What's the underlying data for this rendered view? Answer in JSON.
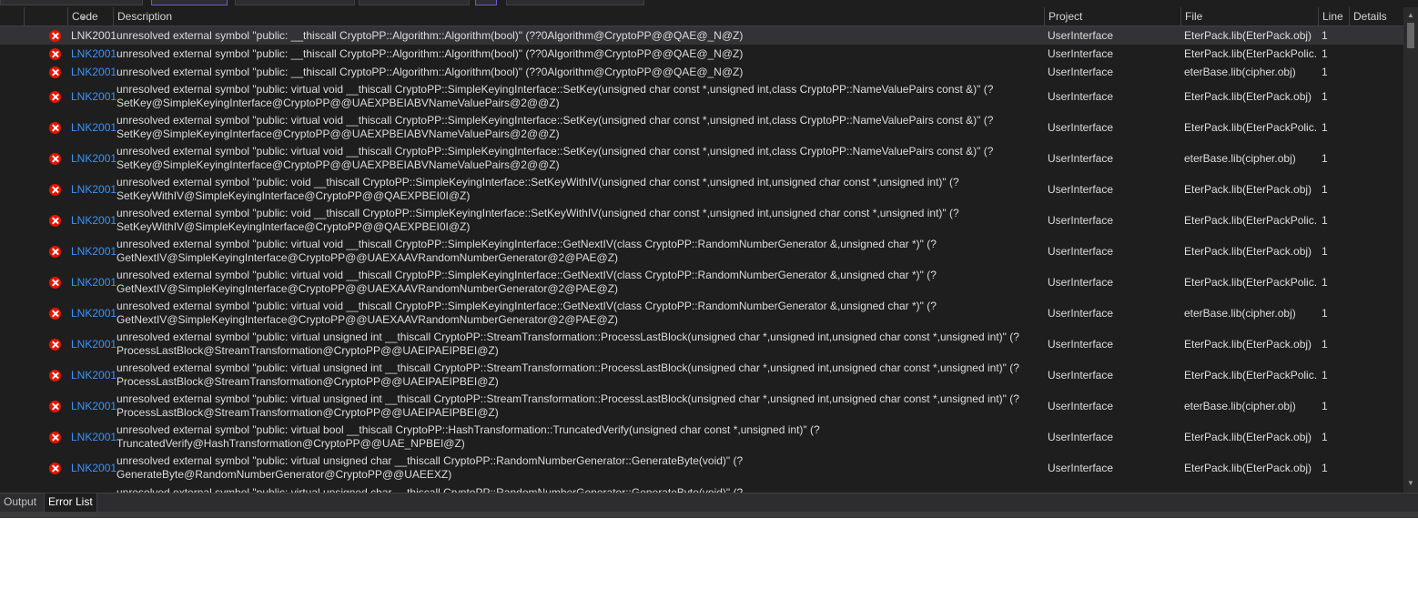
{
  "header": {
    "code": "Code",
    "description": "Description",
    "project": "Project",
    "file": "File",
    "line": "Line",
    "details": "Details"
  },
  "rows": [
    {
      "code": "LNK2001",
      "description": "unresolved external symbol \"public: __thiscall CryptoPP::Algorithm::Algorithm(bool)\" (??0Algorithm@CryptoPP@@QAE@_N@Z)",
      "project": "UserInterface",
      "file": "EterPack.lib(EterPack.obj)",
      "line": "1",
      "selected": true
    },
    {
      "code": "LNK2001",
      "description": "unresolved external symbol \"public: __thiscall CryptoPP::Algorithm::Algorithm(bool)\" (??0Algorithm@CryptoPP@@QAE@_N@Z)",
      "project": "UserInterface",
      "file": "EterPack.lib(EterPackPolic...",
      "line": "1"
    },
    {
      "code": "LNK2001",
      "description": "unresolved external symbol \"public: __thiscall CryptoPP::Algorithm::Algorithm(bool)\" (??0Algorithm@CryptoPP@@QAE@_N@Z)",
      "project": "UserInterface",
      "file": "eterBase.lib(cipher.obj)",
      "line": "1"
    },
    {
      "code": "LNK2001",
      "description": "unresolved external symbol \"public: virtual void __thiscall CryptoPP::SimpleKeyingInterface::SetKey(unsigned char const *,unsigned int,class CryptoPP::NameValuePairs const &)\" (?\nSetKey@SimpleKeyingInterface@CryptoPP@@UAEXPBEIABVNameValuePairs@2@@Z)",
      "project": "UserInterface",
      "file": "EterPack.lib(EterPack.obj)",
      "line": "1"
    },
    {
      "code": "LNK2001",
      "description": "unresolved external symbol \"public: virtual void __thiscall CryptoPP::SimpleKeyingInterface::SetKey(unsigned char const *,unsigned int,class CryptoPP::NameValuePairs const &)\" (?\nSetKey@SimpleKeyingInterface@CryptoPP@@UAEXPBEIABVNameValuePairs@2@@Z)",
      "project": "UserInterface",
      "file": "EterPack.lib(EterPackPolic...",
      "line": "1"
    },
    {
      "code": "LNK2001",
      "description": "unresolved external symbol \"public: virtual void __thiscall CryptoPP::SimpleKeyingInterface::SetKey(unsigned char const *,unsigned int,class CryptoPP::NameValuePairs const &)\" (?\nSetKey@SimpleKeyingInterface@CryptoPP@@UAEXPBEIABVNameValuePairs@2@@Z)",
      "project": "UserInterface",
      "file": "eterBase.lib(cipher.obj)",
      "line": "1"
    },
    {
      "code": "LNK2001",
      "description": "unresolved external symbol \"public: void __thiscall CryptoPP::SimpleKeyingInterface::SetKeyWithIV(unsigned char const *,unsigned int,unsigned char const *,unsigned int)\" (?\nSetKeyWithIV@SimpleKeyingInterface@CryptoPP@@QAEXPBEI0I@Z)",
      "project": "UserInterface",
      "file": "EterPack.lib(EterPack.obj)",
      "line": "1"
    },
    {
      "code": "LNK2001",
      "description": "unresolved external symbol \"public: void __thiscall CryptoPP::SimpleKeyingInterface::SetKeyWithIV(unsigned char const *,unsigned int,unsigned char const *,unsigned int)\" (?\nSetKeyWithIV@SimpleKeyingInterface@CryptoPP@@QAEXPBEI0I@Z)",
      "project": "UserInterface",
      "file": "EterPack.lib(EterPackPolic...",
      "line": "1"
    },
    {
      "code": "LNK2001",
      "description": "unresolved external symbol \"public: virtual void __thiscall CryptoPP::SimpleKeyingInterface::GetNextIV(class CryptoPP::RandomNumberGenerator &,unsigned char *)\" (?\nGetNextIV@SimpleKeyingInterface@CryptoPP@@UAEXAAVRandomNumberGenerator@2@PAE@Z)",
      "project": "UserInterface",
      "file": "EterPack.lib(EterPack.obj)",
      "line": "1"
    },
    {
      "code": "LNK2001",
      "description": "unresolved external symbol \"public: virtual void __thiscall CryptoPP::SimpleKeyingInterface::GetNextIV(class CryptoPP::RandomNumberGenerator &,unsigned char *)\" (?\nGetNextIV@SimpleKeyingInterface@CryptoPP@@UAEXAAVRandomNumberGenerator@2@PAE@Z)",
      "project": "UserInterface",
      "file": "EterPack.lib(EterPackPolic...",
      "line": "1"
    },
    {
      "code": "LNK2001",
      "description": "unresolved external symbol \"public: virtual void __thiscall CryptoPP::SimpleKeyingInterface::GetNextIV(class CryptoPP::RandomNumberGenerator &,unsigned char *)\" (?\nGetNextIV@SimpleKeyingInterface@CryptoPP@@UAEXAAVRandomNumberGenerator@2@PAE@Z)",
      "project": "UserInterface",
      "file": "eterBase.lib(cipher.obj)",
      "line": "1"
    },
    {
      "code": "LNK2001",
      "description": "unresolved external symbol \"public: virtual unsigned int __thiscall CryptoPP::StreamTransformation::ProcessLastBlock(unsigned char *,unsigned int,unsigned char const *,unsigned int)\" (?\nProcessLastBlock@StreamTransformation@CryptoPP@@UAEIPAEIPBEI@Z)",
      "project": "UserInterface",
      "file": "EterPack.lib(EterPack.obj)",
      "line": "1"
    },
    {
      "code": "LNK2001",
      "description": "unresolved external symbol \"public: virtual unsigned int __thiscall CryptoPP::StreamTransformation::ProcessLastBlock(unsigned char *,unsigned int,unsigned char const *,unsigned int)\" (?\nProcessLastBlock@StreamTransformation@CryptoPP@@UAEIPAEIPBEI@Z)",
      "project": "UserInterface",
      "file": "EterPack.lib(EterPackPolic...",
      "line": "1"
    },
    {
      "code": "LNK2001",
      "description": "unresolved external symbol \"public: virtual unsigned int __thiscall CryptoPP::StreamTransformation::ProcessLastBlock(unsigned char *,unsigned int,unsigned char const *,unsigned int)\" (?\nProcessLastBlock@StreamTransformation@CryptoPP@@UAEIPAEIPBEI@Z)",
      "project": "UserInterface",
      "file": "eterBase.lib(cipher.obj)",
      "line": "1"
    },
    {
      "code": "LNK2001",
      "description": "unresolved external symbol \"public: virtual bool __thiscall CryptoPP::HashTransformation::TruncatedVerify(unsigned char const *,unsigned int)\" (?\nTruncatedVerify@HashTransformation@CryptoPP@@UAE_NPBEI@Z)",
      "project": "UserInterface",
      "file": "EterPack.lib(EterPack.obj)",
      "line": "1"
    },
    {
      "code": "LNK2001",
      "description": "unresolved external symbol \"public: virtual unsigned char __thiscall CryptoPP::RandomNumberGenerator::GenerateByte(void)\" (?\nGenerateByte@RandomNumberGenerator@CryptoPP@@UAEEXZ)",
      "project": "UserInterface",
      "file": "EterPack.lib(EterPack.obj)",
      "line": "1"
    },
    {
      "code": "",
      "description": "unresolved external symbol \"public: virtual unsigned char __thiscall CryptoPP::RandomNumberGenerator::GenerateByte(void)\" (?",
      "project": "",
      "file": "",
      "line": "",
      "partial": true
    }
  ],
  "tabs": [
    {
      "label": "Output"
    },
    {
      "label": "Error List",
      "active": true
    }
  ],
  "scrollbar": {
    "up_glyph": "▲",
    "down_glyph": "▼",
    "position": 0.0
  },
  "icons": {
    "error": "error-circle-icon",
    "sort": "sort-indicator-icon"
  },
  "colors": {
    "panel_bg": "#1e1e1e",
    "selected_row": "#333337",
    "code_link": "#3794ff",
    "error_icon": "#e51400"
  }
}
